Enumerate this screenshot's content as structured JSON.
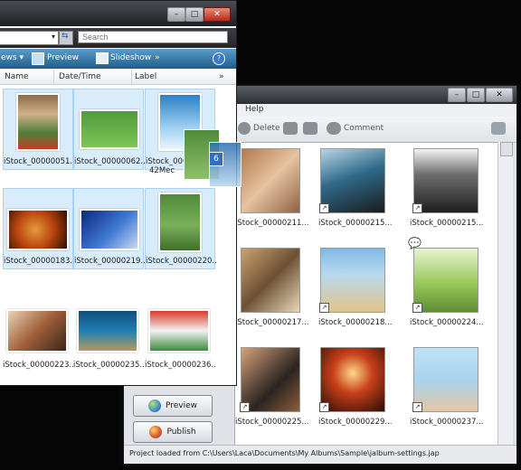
{
  "explorer": {
    "search_placeholder": "Search",
    "views_label": "ews ▾",
    "preview_label": "Preview",
    "slideshow_label": "Slideshow",
    "more_label": "»",
    "help_label": "?",
    "col_name": "Name",
    "col_datetime": "Date/Time",
    "col_label": "Label",
    "col_more": "»",
    "files": [
      {
        "label": "iStock_00000051..."
      },
      {
        "label": "iStock_00000062..."
      },
      {
        "label": "iStock_00000..."
      },
      {
        "label": "iStock_00000183..."
      },
      {
        "label": "iStock_00000219..."
      },
      {
        "label": "iStock_00000220..."
      },
      {
        "label": "iStock_00000223..."
      },
      {
        "label": "iStock_00000235..."
      },
      {
        "label": "iStock_00000236..."
      }
    ],
    "partial_label_suffix": "42Mec",
    "drag_count": "6"
  },
  "jalbum": {
    "menu_help": "Help",
    "toolbar_delete": "Delete",
    "toolbar_comment": "Comment",
    "preview_button": "Preview",
    "publish_button": "Publish",
    "status_text": "Project loaded from C:\\Users\\Laca\\Documents\\My Albums\\Sample\\jalbum-settings.jap",
    "items": [
      {
        "label": "iStock_00000211..."
      },
      {
        "label": "iStock_00000215..."
      },
      {
        "label": "iStock_00000215..."
      },
      {
        "label": "iStock_00000217..."
      },
      {
        "label": "iStock_00000218..."
      },
      {
        "label": "iStock_00000224..."
      },
      {
        "label": "iStock_00000225..."
      },
      {
        "label": "iStock_00000229..."
      },
      {
        "label": "iStock_00000237..."
      }
    ]
  },
  "colors": {
    "cmdbar": "#1f5d88",
    "selection": "#d8ecfb",
    "dark_bg": "#050505"
  }
}
